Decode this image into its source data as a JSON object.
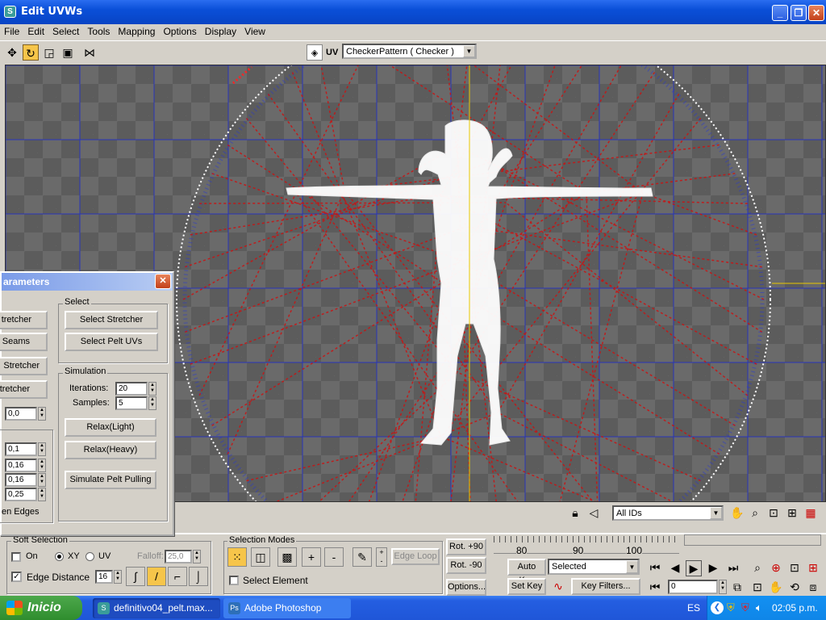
{
  "window": {
    "title": "Edit UVWs",
    "icon": "3dsmax-app-icon",
    "controls": {
      "minimize": "_",
      "maximize": "❐",
      "close": "✕"
    }
  },
  "menu": [
    "File",
    "Edit",
    "Select",
    "Tools",
    "Mapping",
    "Options",
    "Display",
    "View"
  ],
  "toolbar": {
    "tools": [
      "move-icon",
      "rotate-icon",
      "scale-icon",
      "freeform-icon",
      "mirror-icon"
    ],
    "uv_label": "UV",
    "map_select": "CheckerPattern  ( Checker )"
  },
  "panel": {
    "title": "arameters",
    "left_buttons": [
      "tretcher",
      "Seams",
      "Stretcher",
      "tretcher"
    ],
    "left_spinners": [
      "0,0",
      "0,1",
      "0,16",
      "0,16",
      "0,25"
    ],
    "left_footer": "en Edges",
    "select_group": {
      "label": "Select",
      "buttons": [
        "Select Stretcher",
        "Select Pelt UVs"
      ]
    },
    "simulation_group": {
      "label": "Simulation",
      "iterations_label": "Iterations:",
      "iterations_value": "20",
      "samples_label": "Samples:",
      "samples_value": "5",
      "buttons": [
        "Relax(Light)",
        "Relax(Heavy)",
        "Simulate Pelt Pulling"
      ]
    }
  },
  "viewport_status": {
    "ids_select": "All IDs",
    "icons": [
      "lock-icon",
      "paint-icon",
      "pan-icon",
      "zoom-icon",
      "zoom-region-icon",
      "zoom-extents-icon",
      "checker-toggle-icon"
    ]
  },
  "soft_selection": {
    "label": "Soft Selection",
    "on_label": "On",
    "xy_label": "XY",
    "uv_label": "UV",
    "falloff_label": "Falloff:",
    "falloff_value": "25,0",
    "edge_distance_label": "Edge Distance",
    "edge_distance_value": "16"
  },
  "selection_modes": {
    "label": "Selection Modes",
    "edge_loop": "Edge Loop",
    "select_element": "Select Element"
  },
  "rotate": {
    "plus": "Rot. +90",
    "minus": "Rot. -90",
    "options": "Options..."
  },
  "timeline": {
    "ticks": [
      "80",
      "90",
      "100"
    ]
  },
  "animation": {
    "auto_key": "Auto Key",
    "set_key": "Set Key",
    "selected": "Selected",
    "key_filters": "Key Filters...",
    "frame": "0"
  },
  "taskbar": {
    "start": "Inicio",
    "tasks": [
      {
        "label": "definitivo04_pelt.max...",
        "icon": "3dsmax-task-icon",
        "active": true
      },
      {
        "label": "Adobe Photoshop",
        "icon": "photoshop-task-icon",
        "active": false
      }
    ],
    "lang": "ES",
    "clock": "02:05 p.m."
  }
}
